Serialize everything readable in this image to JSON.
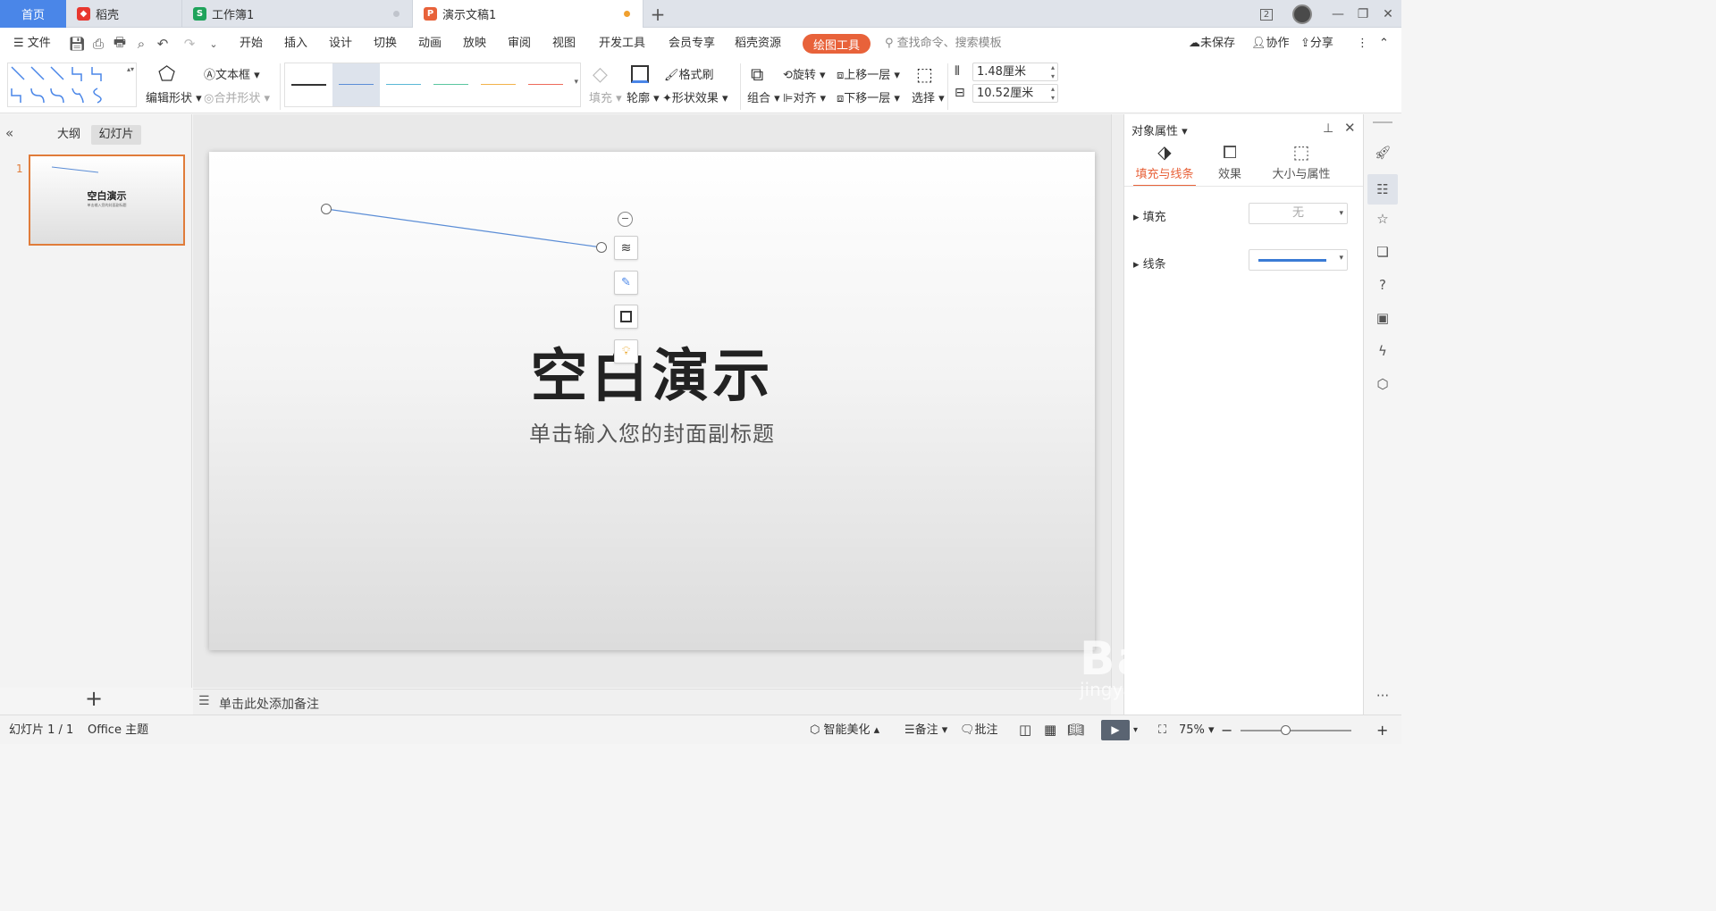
{
  "tabs": [
    {
      "label": "首页",
      "active": false,
      "home": true
    },
    {
      "label": "稻壳",
      "icon": "daoke-icon"
    },
    {
      "label": "工作簿1",
      "icon": "spreadsheet-icon",
      "icon_letter": "S"
    },
    {
      "label": "演示文稿1",
      "icon": "presentation-icon",
      "icon_letter": "P",
      "active": true
    }
  ],
  "window": {
    "badge": "2"
  },
  "menu": {
    "file": "文件",
    "items": [
      "开始",
      "插入",
      "设计",
      "切换",
      "动画",
      "放映",
      "审阅",
      "视图",
      "开发工具",
      "会员专享",
      "稻壳资源"
    ],
    "drawing_tools": "绘图工具",
    "search_placeholder": "查找命令、搜索模板",
    "unsaved": "未保存",
    "collab": "协作",
    "share": "分享"
  },
  "ribbon": {
    "edit_shape": "编辑形状",
    "textbox": "文本框",
    "merge_shape": "合并形状",
    "fill": "填充",
    "outline": "轮廓",
    "format_painter": "格式刷",
    "shape_effect": "形状效果",
    "rotate": "旋转",
    "align": "对齐",
    "group": "组合",
    "bring_forward": "上移一层",
    "send_backward": "下移一层",
    "select": "选择",
    "height_value": "1.48厘米",
    "width_value": "10.52厘米",
    "line_styles": [
      "#333333",
      "#5b8dd6",
      "#5bb8d6",
      "#5bc6a0",
      "#f2b34a",
      "#ee6a5a"
    ]
  },
  "leftpanel": {
    "tab_outline": "大纲",
    "tab_slides": "幻灯片",
    "slide_number": "1",
    "thumb_title": "空白演示",
    "thumb_subtitle": "单击输入您的封面副标题"
  },
  "slide": {
    "title": "空白演示",
    "subtitle": "单击输入您的封面副标题"
  },
  "notes": {
    "placeholder": "单击此处添加备注"
  },
  "rightpanel": {
    "header": "对象属性",
    "tabs": [
      "填充与线条",
      "效果",
      "大小与属性"
    ],
    "fill_label": "填充",
    "fill_value": "无",
    "line_label": "线条",
    "line_color": "#3a7bd5"
  },
  "statusbar": {
    "slide_info": "幻灯片 1 / 1",
    "theme": "Office 主题",
    "smart": "智能美化",
    "notes": "备注",
    "comments": "批注",
    "zoom": "75%"
  },
  "watermark": {
    "brand": "Bai经验",
    "url": "jingyan.baidu.com"
  },
  "colors": {
    "accent": "#e8623a",
    "tab_active_bg": "#ffffff",
    "home_tab_bg": "#4a86e8",
    "selection": "#e07c3a",
    "line": "#5b8dd6"
  }
}
